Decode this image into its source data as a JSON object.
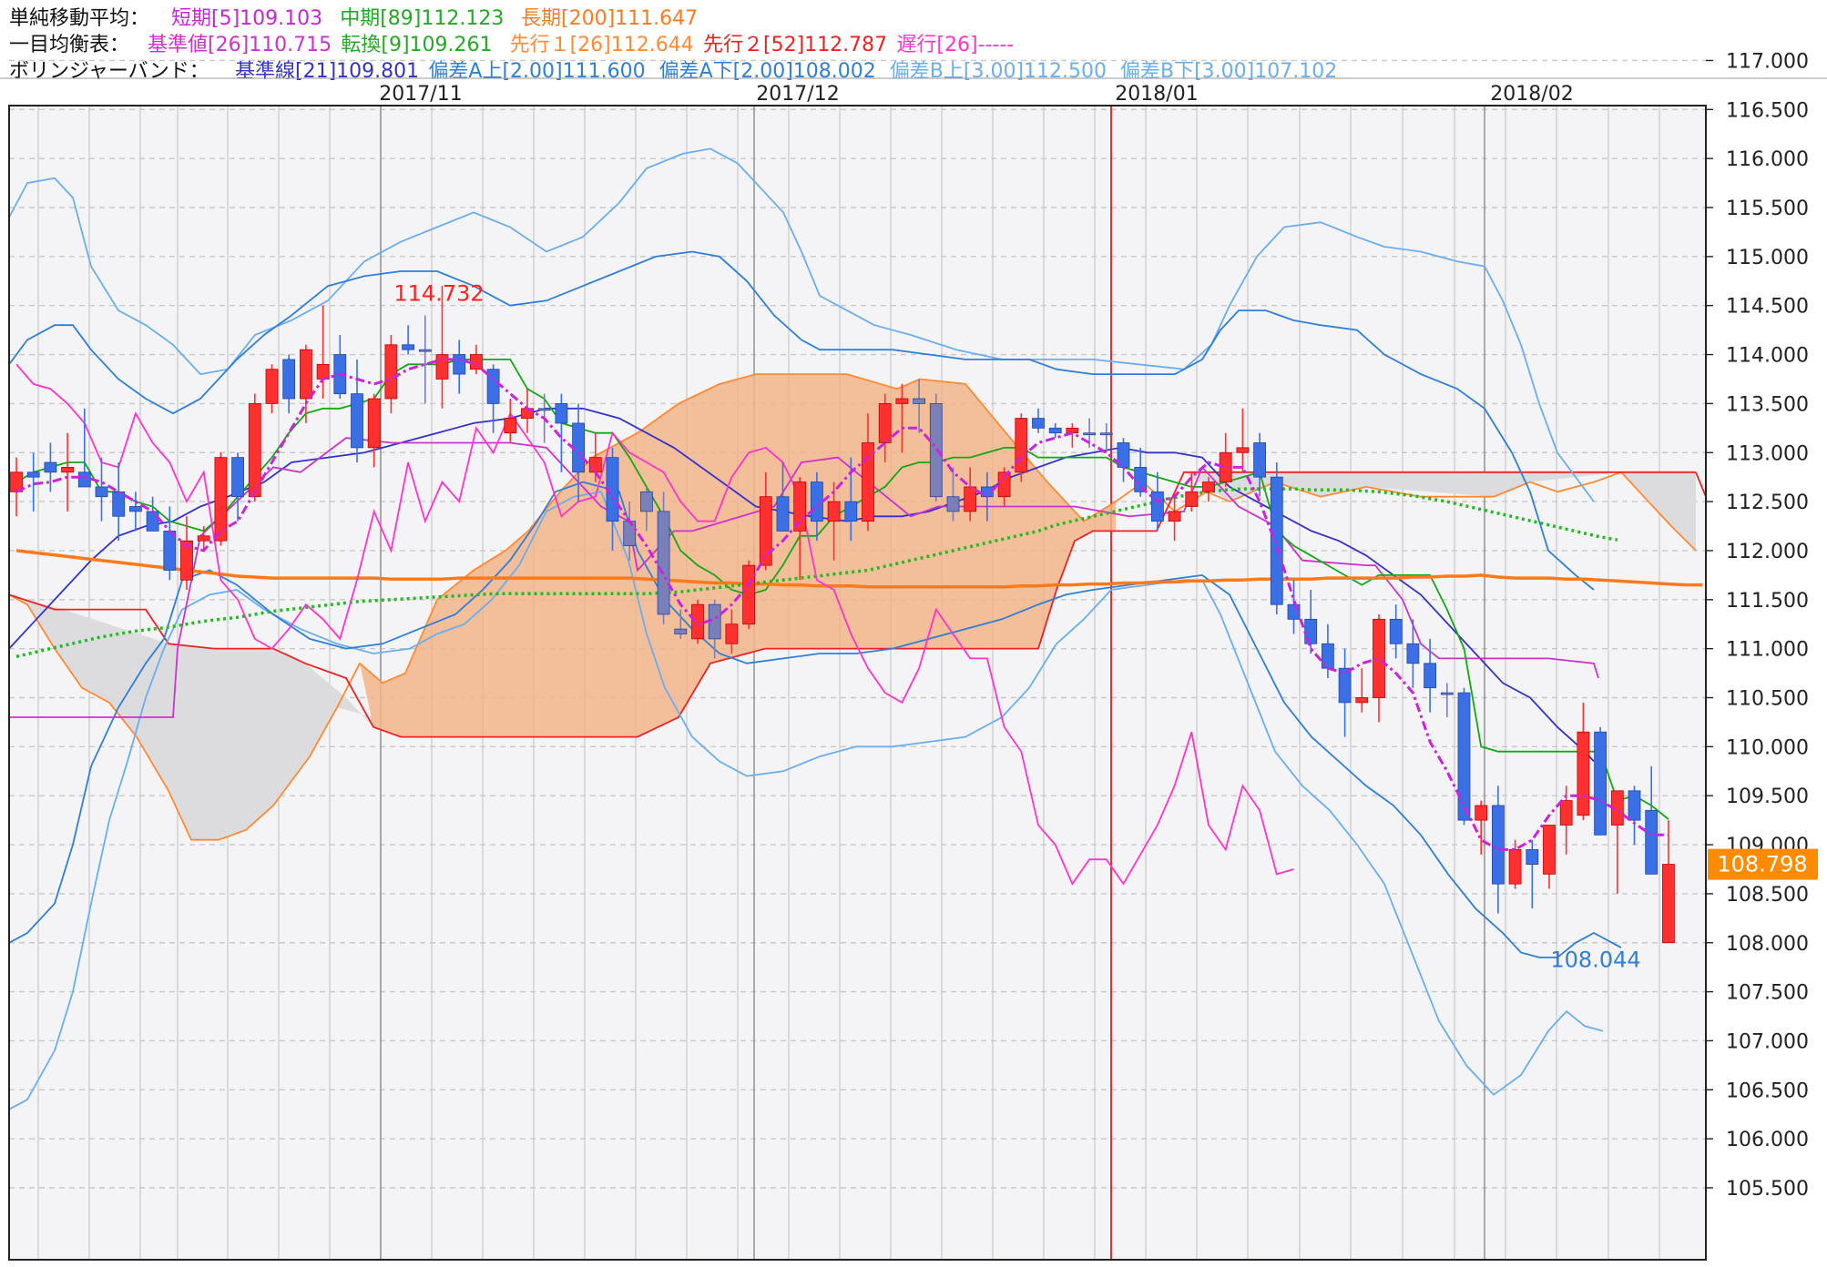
{
  "legend": {
    "rows": [
      {
        "label": "単純移動平均：",
        "items": [
          {
            "text": "短期[5]109.103",
            "color": "#cc22dd"
          },
          {
            "text": "中期[89]112.123",
            "color": "#22aa22"
          },
          {
            "text": "長期[200]111.647",
            "color": "#ff7a1a"
          }
        ]
      },
      {
        "label": "一目均衡表：",
        "items": [
          {
            "text": "基準値[26]110.715",
            "color": "#cc33cc"
          },
          {
            "text": "転換[9]109.261",
            "color": "#22aa22"
          },
          {
            "text": "先行１[26]112.644",
            "color": "#ff8a33"
          },
          {
            "text": "先行２[52]112.787",
            "color": "#ee2222"
          },
          {
            "text": "遅行[26]-----",
            "color": "#ff33cc"
          }
        ]
      },
      {
        "label": "ボリンジャーバンド：",
        "items": [
          {
            "text": "基準線[21]109.801",
            "color": "#3333cc"
          },
          {
            "text": "偏差A上[2.00]111.600",
            "color": "#2f7fd8"
          },
          {
            "text": "偏差A下[2.00]108.002",
            "color": "#2f7fd8"
          },
          {
            "text": "偏差B上[3.00]112.500",
            "color": "#6aaef0"
          },
          {
            "text": "偏差B下[3.00]107.102",
            "color": "#6aaef0"
          }
        ]
      }
    ]
  },
  "chart_data": {
    "type": "candlestick",
    "ylim": [
      105.3,
      117.15
    ],
    "y_ticks": [
      "117.000",
      "116.500",
      "116.000",
      "115.500",
      "115.000",
      "114.500",
      "114.000",
      "113.500",
      "113.000",
      "112.500",
      "112.000",
      "111.500",
      "111.000",
      "110.500",
      "110.000",
      "109.500",
      "109.000",
      "108.500",
      "108.000",
      "107.500",
      "107.000",
      "106.500",
      "106.000",
      "105.500"
    ],
    "month_labels": [
      "2017/11",
      "2017/12",
      "2018/01",
      "2018/02"
    ],
    "high_label": "114.732",
    "low_label": "108.044",
    "last_price": "108.798",
    "colors": {
      "up": "#ff3030",
      "down": "#3a6fe6",
      "neutral": "#7b7fb8",
      "cloud_fill": "#f2b48a",
      "cloud_fill_neg": "#dcdcdf",
      "sma_short": "#cc22dd",
      "sma_mid": "#22bb22",
      "sma_long": "#ff7a1a",
      "kijun": "#cc33cc",
      "tenkan": "#11aa11",
      "senkou1": "#ff8a33",
      "senkou2": "#ee2222",
      "chikou": "#ff33cc",
      "bb_mid": "#3333cc",
      "bb_a": "#2f7fd8",
      "bb_b": "#6aaef0",
      "grid": "#c8c8c8",
      "bg": "#f4f4f6",
      "price_box": "#ff8c00"
    },
    "candles": [
      [
        112.6,
        112.95,
        112.35,
        112.8
      ],
      [
        112.8,
        113.0,
        112.4,
        112.75
      ],
      [
        112.9,
        113.1,
        112.6,
        112.8
      ],
      [
        112.8,
        113.2,
        112.4,
        112.85
      ],
      [
        112.8,
        113.45,
        112.65,
        112.65
      ],
      [
        112.65,
        112.95,
        112.3,
        112.55
      ],
      [
        112.6,
        112.9,
        112.1,
        112.35
      ],
      [
        112.45,
        112.6,
        112.2,
        112.4
      ],
      [
        112.4,
        112.55,
        112.2,
        112.2
      ],
      [
        112.2,
        112.45,
        111.7,
        111.8
      ],
      [
        111.7,
        112.35,
        111.6,
        112.1
      ],
      [
        112.1,
        112.25,
        112.0,
        112.15
      ],
      [
        112.1,
        113.0,
        112.05,
        112.95
      ],
      [
        112.95,
        113.0,
        112.3,
        112.55
      ],
      [
        112.55,
        113.6,
        112.5,
        113.5
      ],
      [
        113.5,
        113.9,
        113.4,
        113.85
      ],
      [
        113.95,
        114.0,
        113.4,
        113.55
      ],
      [
        113.55,
        114.1,
        113.3,
        114.05
      ],
      [
        113.75,
        114.5,
        113.55,
        113.9
      ],
      [
        114.0,
        114.2,
        113.55,
        113.6
      ],
      [
        113.6,
        113.95,
        112.9,
        113.05
      ],
      [
        113.05,
        113.6,
        112.85,
        113.55
      ],
      [
        113.55,
        114.2,
        113.4,
        114.1
      ],
      [
        114.1,
        114.3,
        114.0,
        114.05
      ],
      [
        114.05,
        114.4,
        113.5,
        114.05
      ],
      [
        113.75,
        114.7,
        113.45,
        114.0
      ],
      [
        114.0,
        114.15,
        113.6,
        113.8
      ],
      [
        113.85,
        114.1,
        113.8,
        114.0
      ],
      [
        113.85,
        113.9,
        113.2,
        113.5
      ],
      [
        113.2,
        113.55,
        113.1,
        113.35
      ],
      [
        113.35,
        113.65,
        113.2,
        113.45
      ],
      [
        113.45,
        113.6,
        113.1,
        113.45
      ],
      [
        113.5,
        113.6,
        112.8,
        113.3
      ],
      [
        113.3,
        113.5,
        112.5,
        112.8
      ],
      [
        112.8,
        113.2,
        112.7,
        112.95
      ],
      [
        112.95,
        113.05,
        112.0,
        112.3
      ],
      [
        112.3,
        112.5,
        111.9,
        112.05
      ],
      [
        112.6,
        112.65,
        112.2,
        112.4
      ],
      [
        112.4,
        112.6,
        111.25,
        111.35
      ],
      [
        111.2,
        111.4,
        111.1,
        111.15
      ],
      [
        111.1,
        111.5,
        111.05,
        111.45
      ],
      [
        111.45,
        111.5,
        110.9,
        111.1
      ],
      [
        111.05,
        111.4,
        110.95,
        111.25
      ],
      [
        111.25,
        111.9,
        111.2,
        111.85
      ],
      [
        111.85,
        112.8,
        111.8,
        112.55
      ],
      [
        112.55,
        112.9,
        112.4,
        112.2
      ],
      [
        112.2,
        112.75,
        111.7,
        112.7
      ],
      [
        112.7,
        112.8,
        112.1,
        112.3
      ],
      [
        112.3,
        112.7,
        111.9,
        112.5
      ],
      [
        112.5,
        112.95,
        112.1,
        112.3
      ],
      [
        112.3,
        113.4,
        112.2,
        113.1
      ],
      [
        113.1,
        113.6,
        112.9,
        113.5
      ],
      [
        113.5,
        113.7,
        113.0,
        113.55
      ],
      [
        113.55,
        113.75,
        113.2,
        113.5
      ],
      [
        113.5,
        113.6,
        112.5,
        112.55
      ],
      [
        112.55,
        112.85,
        112.3,
        112.4
      ],
      [
        112.4,
        112.85,
        112.3,
        112.65
      ],
      [
        112.65,
        112.8,
        112.3,
        112.55
      ],
      [
        112.55,
        112.85,
        112.45,
        112.8
      ],
      [
        112.8,
        113.4,
        112.7,
        113.35
      ],
      [
        113.35,
        113.45,
        113.2,
        113.25
      ],
      [
        113.25,
        113.3,
        113.15,
        113.2
      ],
      [
        113.2,
        113.3,
        113.05,
        113.25
      ],
      [
        113.2,
        113.35,
        113.05,
        113.2
      ],
      [
        113.2,
        113.3,
        113.0,
        113.2
      ],
      [
        113.1,
        113.15,
        112.7,
        112.85
      ],
      [
        112.85,
        113.05,
        112.55,
        112.6
      ],
      [
        112.6,
        112.8,
        112.2,
        112.3
      ],
      [
        112.3,
        112.6,
        112.1,
        112.4
      ],
      [
        112.45,
        112.8,
        112.4,
        112.6
      ],
      [
        112.6,
        112.75,
        112.5,
        112.7
      ],
      [
        112.7,
        113.2,
        112.65,
        113.0
      ],
      [
        113.0,
        113.45,
        112.8,
        113.05
      ],
      [
        113.1,
        113.2,
        112.55,
        112.75
      ],
      [
        112.75,
        112.9,
        111.35,
        111.45
      ],
      [
        111.45,
        111.7,
        111.15,
        111.3
      ],
      [
        111.3,
        111.6,
        110.95,
        111.05
      ],
      [
        111.05,
        111.25,
        110.7,
        110.8
      ],
      [
        110.8,
        111.0,
        110.1,
        110.45
      ],
      [
        110.45,
        110.8,
        110.35,
        110.5
      ],
      [
        110.5,
        111.35,
        110.25,
        111.3
      ],
      [
        111.3,
        111.45,
        110.9,
        111.05
      ],
      [
        111.05,
        111.3,
        110.6,
        110.85
      ],
      [
        110.85,
        111.1,
        110.35,
        110.6
      ],
      [
        110.55,
        110.65,
        110.3,
        110.55
      ],
      [
        110.55,
        110.6,
        109.2,
        109.25
      ],
      [
        109.25,
        109.45,
        108.9,
        109.4
      ],
      [
        109.4,
        109.6,
        108.3,
        108.6
      ],
      [
        108.6,
        109.05,
        108.55,
        108.95
      ],
      [
        108.95,
        109.05,
        108.35,
        108.8
      ],
      [
        108.7,
        109.1,
        108.55,
        109.2
      ],
      [
        109.2,
        109.6,
        108.9,
        109.45
      ],
      [
        109.3,
        110.45,
        109.25,
        110.15
      ],
      [
        110.15,
        110.2,
        109.1,
        109.1
      ],
      [
        109.2,
        109.55,
        108.5,
        109.55
      ],
      [
        109.55,
        109.6,
        109.0,
        109.25
      ],
      [
        109.35,
        109.8,
        108.75,
        108.7
      ],
      [
        108.0,
        109.25,
        108.0,
        108.8
      ]
    ],
    "ichimoku_tenkan": [
      112.7,
      112.8,
      112.85,
      112.9,
      112.9,
      112.6,
      112.6,
      112.5,
      112.45,
      112.3,
      112.25,
      112.2,
      112.35,
      112.55,
      112.75,
      112.95,
      113.2,
      113.4,
      113.45,
      113.45,
      113.5,
      113.55,
      113.8,
      113.9,
      113.9,
      113.9,
      113.95,
      113.95,
      113.95,
      113.95,
      113.65,
      113.55,
      113.3,
      113.25,
      113.2,
      113.2,
      112.95,
      112.65,
      112.35,
      112.0,
      111.85,
      111.75,
      111.6,
      111.55,
      111.6,
      111.85,
      112.15,
      112.15,
      112.35,
      112.45,
      112.55,
      112.65,
      112.85,
      112.9,
      112.9,
      112.95,
      112.95,
      113.0,
      113.05,
      113.05,
      112.95,
      112.95,
      112.95,
      112.95,
      112.95,
      112.85,
      112.8,
      112.75,
      112.7,
      112.65,
      112.65,
      112.7,
      112.75,
      112.8,
      112.2,
      112.05,
      111.95,
      111.85,
      111.75,
      111.65,
      111.75,
      111.75,
      111.75,
      111.75,
      111.4,
      111.0,
      110.0,
      109.95,
      109.95,
      109.95,
      109.95,
      109.95,
      109.95,
      109.95,
      109.45,
      109.5,
      109.4,
      109.26
    ],
    "sma_short": [
      112.6,
      112.68,
      112.7,
      112.75,
      112.75,
      112.7,
      112.6,
      112.5,
      112.4,
      112.2,
      112.05,
      112.0,
      112.2,
      112.3,
      112.6,
      112.9,
      113.2,
      113.5,
      113.75,
      113.8,
      113.75,
      113.7,
      113.75,
      113.85,
      113.9,
      113.95,
      113.95,
      113.9,
      113.75,
      113.6,
      113.45,
      113.35,
      113.15,
      113.0,
      112.8,
      112.55,
      112.3,
      112.05,
      111.75,
      111.45,
      111.25,
      111.3,
      111.45,
      111.65,
      111.95,
      112.1,
      112.3,
      112.45,
      112.6,
      112.8,
      112.95,
      113.1,
      113.25,
      113.25,
      113.05,
      112.8,
      112.65,
      112.55,
      112.75,
      112.95,
      113.1,
      113.15,
      113.2,
      113.1,
      113.0,
      112.85,
      112.65,
      112.5,
      112.55,
      112.75,
      112.9,
      112.85,
      112.85,
      112.5,
      112.05,
      111.5,
      111.0,
      110.8,
      110.75,
      110.85,
      110.9,
      110.75,
      110.55,
      110.05,
      109.75,
      109.4,
      109.05,
      108.95,
      108.95,
      109.05,
      109.3,
      109.5,
      109.5,
      109.45,
      109.35,
      109.22,
      109.1,
      109.1
    ],
    "sma_mid": [
      110.92,
      110.96,
      111.0,
      111.04,
      111.08,
      111.12,
      111.15,
      111.18,
      111.2,
      111.22,
      111.25,
      111.28,
      111.3,
      111.32,
      111.35,
      111.38,
      111.4,
      111.42,
      111.44,
      111.46,
      111.48,
      111.49,
      111.5,
      111.51,
      111.52,
      111.53,
      111.54,
      111.55,
      111.56,
      111.56,
      111.56,
      111.56,
      111.56,
      111.56,
      111.56,
      111.56,
      111.56,
      111.56,
      111.57,
      111.58,
      111.6,
      111.62,
      111.64,
      111.66,
      111.68,
      111.7,
      111.72,
      111.74,
      111.76,
      111.78,
      111.8,
      111.84,
      111.88,
      111.92,
      111.96,
      112.0,
      112.04,
      112.08,
      112.12,
      112.16,
      112.2,
      112.26,
      112.3,
      112.34,
      112.38,
      112.42,
      112.46,
      112.5,
      112.54,
      112.58,
      112.6,
      112.62,
      112.63,
      112.63,
      112.63,
      112.63,
      112.62,
      112.62,
      112.62,
      112.61,
      112.6,
      112.58,
      112.56,
      112.53,
      112.5,
      112.46,
      112.42,
      112.38,
      112.34,
      112.3,
      112.26,
      112.22,
      112.18,
      112.14,
      112.11
    ],
    "sma_long": [
      112.0,
      111.98,
      111.96,
      111.94,
      111.92,
      111.9,
      111.88,
      111.86,
      111.84,
      111.82,
      111.8,
      111.78,
      111.76,
      111.74,
      111.73,
      111.72,
      111.72,
      111.72,
      111.72,
      111.72,
      111.72,
      111.72,
      111.71,
      111.71,
      111.71,
      111.71,
      111.72,
      111.72,
      111.72,
      111.72,
      111.72,
      111.72,
      111.72,
      111.72,
      111.72,
      111.72,
      111.72,
      111.71,
      111.7,
      111.69,
      111.68,
      111.67,
      111.67,
      111.66,
      111.66,
      111.65,
      111.65,
      111.64,
      111.64,
      111.64,
      111.63,
      111.63,
      111.63,
      111.63,
      111.63,
      111.63,
      111.63,
      111.63,
      111.63,
      111.64,
      111.64,
      111.65,
      111.65,
      111.66,
      111.66,
      111.67,
      111.67,
      111.68,
      111.68,
      111.69,
      111.69,
      111.7,
      111.7,
      111.71,
      111.71,
      111.71,
      111.71,
      111.72,
      111.72,
      111.72,
      111.72,
      111.72,
      111.73,
      111.73,
      111.74,
      111.74,
      111.75,
      111.73,
      111.72,
      111.72,
      111.72,
      111.71,
      111.71,
      111.7,
      111.69,
      111.68,
      111.67,
      111.66,
      111.65,
      111.65
    ],
    "chikou": [
      113.9,
      113.7,
      113.65,
      113.5,
      113.3,
      112.9,
      112.85,
      113.4,
      113.1,
      112.9,
      112.5,
      112.8,
      111.7,
      111.5,
      111.1,
      111.0,
      111.2,
      111.45,
      111.3,
      111.1,
      111.7,
      112.4,
      112.0,
      112.9,
      112.3,
      112.7,
      112.5,
      113.25,
      113.0,
      113.4,
      113.15,
      112.9,
      112.35,
      112.5,
      112.55,
      113.2,
      113.0,
      112.9,
      112.8,
      112.5,
      112.3,
      112.3,
      112.75,
      113.0,
      113.05,
      112.9,
      112.55,
      111.7,
      111.6,
      111.15,
      110.8,
      110.55,
      110.45,
      110.8,
      111.4,
      111.15,
      110.9,
      110.9,
      110.2,
      109.95,
      109.2,
      109.0,
      108.6,
      108.85,
      108.85,
      108.6,
      108.9,
      109.2,
      109.6,
      110.15,
      109.2,
      108.95,
      109.6,
      109.35,
      108.7,
      108.75
    ]
  }
}
